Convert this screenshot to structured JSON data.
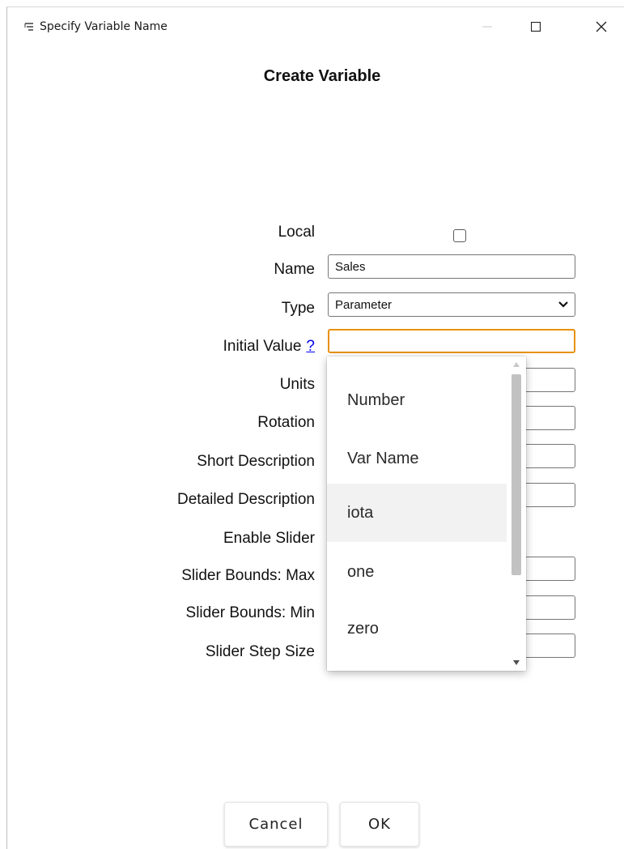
{
  "window": {
    "title": "Specify Variable Name",
    "icon": "app-icon",
    "controls": {
      "minimize": "minimize-icon",
      "maximize": "maximize-icon",
      "close": "close-icon"
    }
  },
  "dialog": {
    "title": "Create Variable"
  },
  "form": {
    "local_label": "Local",
    "local_checked": false,
    "name_label": "Name",
    "name_value": "Sales",
    "type_label": "Type",
    "type_value": "Parameter",
    "initial_value_label": "Initial Value",
    "initial_value_help": "?",
    "initial_value_value": "",
    "units_label": "Units",
    "rotation_label": "Rotation",
    "short_description_label": "Short Description",
    "detailed_description_label": "Detailed Description",
    "enable_slider_label": "Enable Slider",
    "slider_max_label": "Slider Bounds: Max",
    "slider_min_label": "Slider Bounds: Min",
    "slider_step_label": "Slider Step Size"
  },
  "initial_value_dropdown": {
    "options": [
      "Number",
      "Var Name",
      "iota",
      "one",
      "zero"
    ],
    "highlighted": "iota"
  },
  "buttons": {
    "cancel": "Cancel",
    "ok": "OK"
  },
  "colors": {
    "focus_border": "#e8910c",
    "link": "#0000ee"
  }
}
